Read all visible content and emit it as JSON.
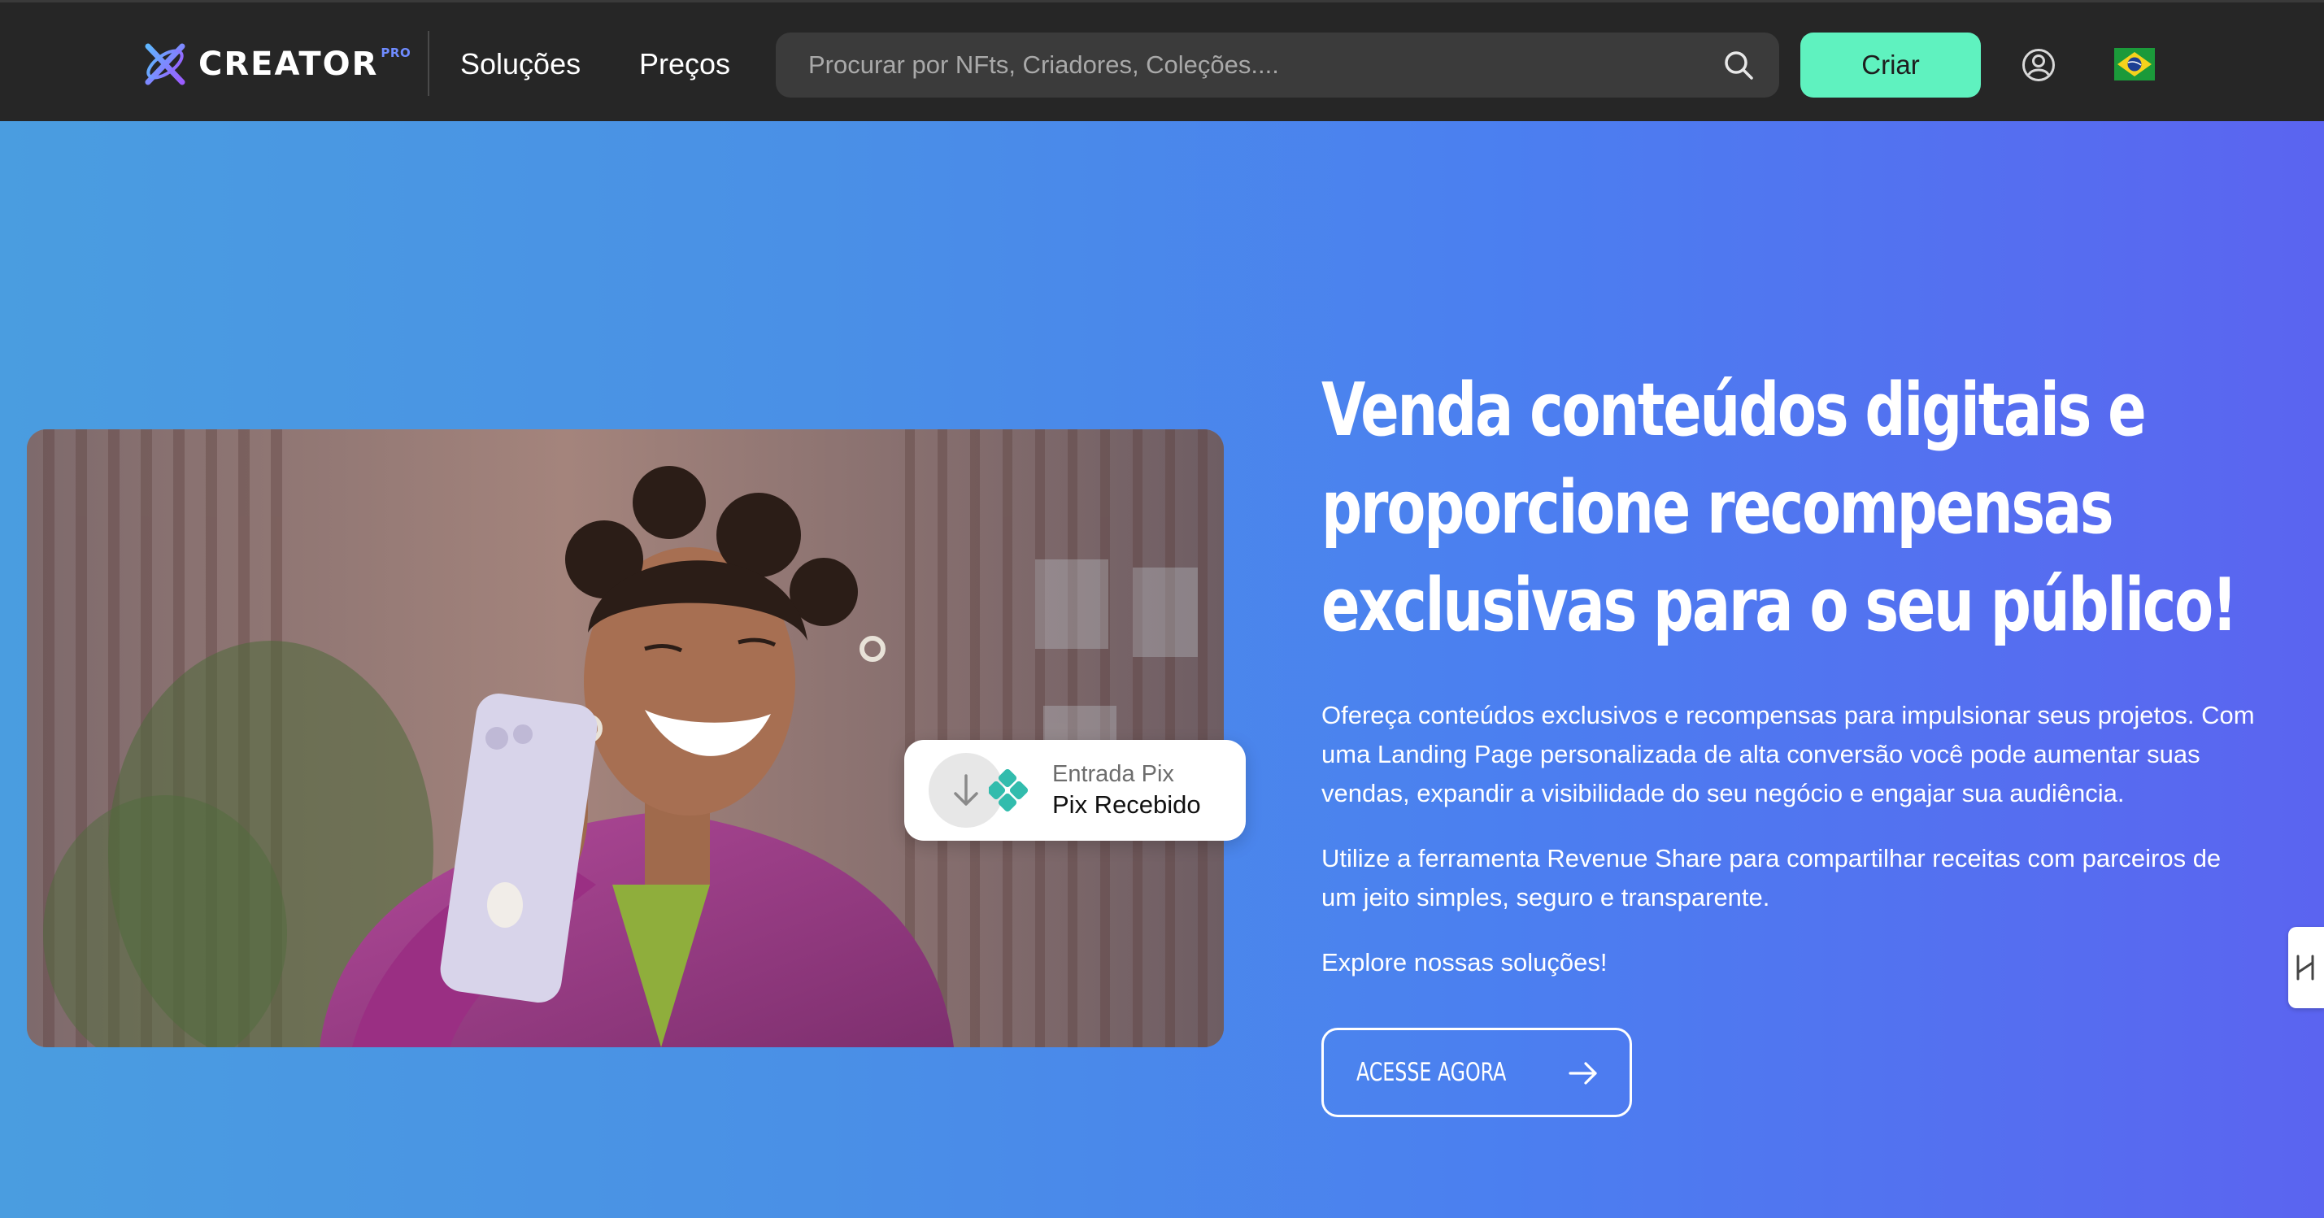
{
  "header": {
    "logo_text": "CREATOR",
    "logo_sup": "PRO",
    "nav": [
      {
        "label": "Soluções"
      },
      {
        "label": "Preços"
      }
    ],
    "search_placeholder": "Procurar por NFts, Criadores, Coleções....",
    "create_label": "Criar",
    "icons": [
      "search-icon",
      "user-icon",
      "brazil-flag-icon"
    ]
  },
  "hero": {
    "title_lines": [
      "Venda conteúdos digitais e",
      "proporcione recompensas",
      "exclusivas para o seu público!"
    ],
    "paragraph_1": "Ofereça conteúdos exclusivos e recompensas para impulsionar seus projetos. Com uma Landing Page personalizada de alta conversão você pode aumentar suas vendas, expandir a visibilidade do seu negócio e engajar sua audiência.",
    "paragraph_2": "Utilize a ferramenta Revenue Share para compartilhar receitas com parceiros de um jeito simples, seguro e transparente.",
    "paragraph_3": "Explore nossas soluções!",
    "cta_label": "ACESSE AGORA",
    "pix_card": {
      "label": "Entrada Pix",
      "status": "Pix Recebido"
    }
  },
  "colors": {
    "header_bg": "#262626",
    "accent_green": "#5ff2bf",
    "hero_gradient_start": "#4a9de0",
    "hero_gradient_end": "#5b64f0"
  }
}
